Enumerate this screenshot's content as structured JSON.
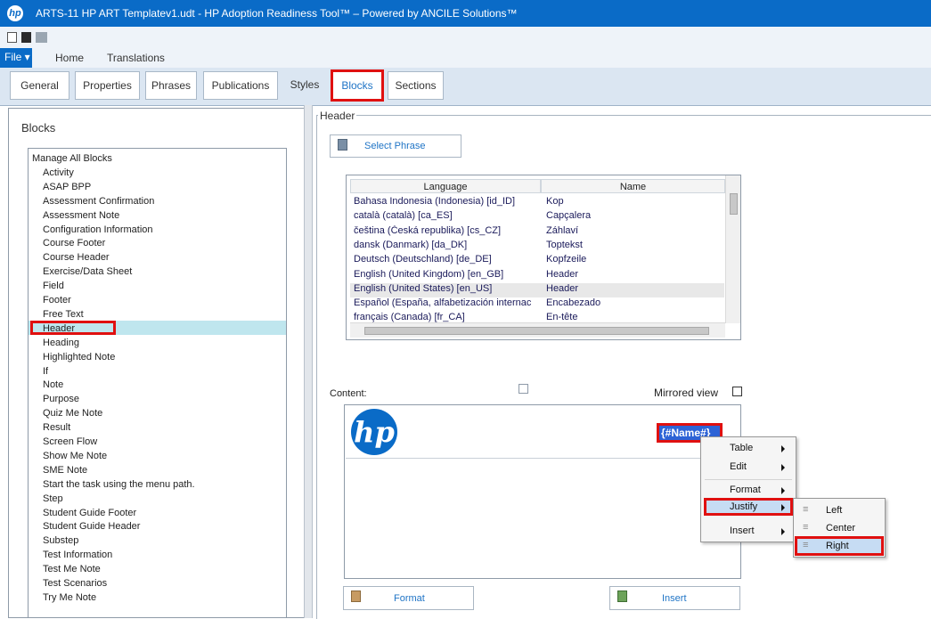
{
  "window": {
    "title": "ARTS-11 HP ART Templatev1.udt - HP Adoption Readiness Tool™ – Powered by ANCILE Solutions™",
    "logo": "hp"
  },
  "ribbon": {
    "file_label": "File",
    "tabs": [
      "Home",
      "Translations"
    ]
  },
  "tabs": [
    "General",
    "Properties",
    "Phrases",
    "Publications",
    "Styles",
    "Blocks",
    "Sections"
  ],
  "active_tab": "Blocks",
  "blocks": {
    "title": "Blocks",
    "items": [
      "Manage All Blocks",
      "Activity",
      "ASAP BPP",
      "Assessment Confirmation",
      "Assessment Note",
      "Configuration Information",
      "Course Footer",
      "Course Header",
      "Exercise/Data Sheet",
      "Field",
      "Footer",
      "Free Text",
      "Header",
      "Heading",
      "Highlighted Note",
      "If",
      "Note",
      "Purpose",
      "Quiz Me Note",
      "Result",
      "Screen Flow",
      "Show Me Note",
      "SME Note",
      "Start the task using the menu path.",
      "Step",
      "Student Guide Footer",
      "Student Guide Header",
      "Substep",
      "Test Information",
      "Test Me Note",
      "Test Scenarios",
      "Try Me Note"
    ],
    "selected": "Header"
  },
  "header_group": {
    "legend": "Header",
    "select_phrase_label": "Select Phrase",
    "columns": [
      "Language",
      "Name"
    ],
    "rows": [
      [
        "Bahasa Indonesia (Indonesia) [id_ID]",
        "Kop"
      ],
      [
        "català (català) [ca_ES]",
        "Capçalera"
      ],
      [
        "čeština (Česká republika) [cs_CZ]",
        "Záhlaví"
      ],
      [
        "dansk (Danmark) [da_DK]",
        "Toptekst"
      ],
      [
        "Deutsch (Deutschland) [de_DE]",
        "Kopfzeile"
      ],
      [
        "English (United Kingdom) [en_GB]",
        "Header"
      ],
      [
        "English (United States) [en_US]",
        "Header"
      ],
      [
        "Español (España, alfabetización internac",
        "Encabezado"
      ],
      [
        "français (Canada) [fr_CA]",
        "En-tête"
      ]
    ],
    "selected_row": 6,
    "content_label": "Content:",
    "mirrored_label": "Mirrored view",
    "content_logo": "hp",
    "name_token": "{#Name#}",
    "format_label": "Format",
    "insert_label": "Insert"
  },
  "context_menu": {
    "items": [
      "Table",
      "Edit",
      "Format",
      "Justify",
      "Insert"
    ],
    "highlighted": "Justify",
    "submenu": [
      "Left",
      "Center",
      "Right"
    ],
    "submenu_highlighted": "Right"
  },
  "colors": {
    "accent": "#0a6bc7",
    "highlight_red": "#e01010",
    "selection_blue": "#2d63d6",
    "list_selection": "#bfe6ee"
  }
}
